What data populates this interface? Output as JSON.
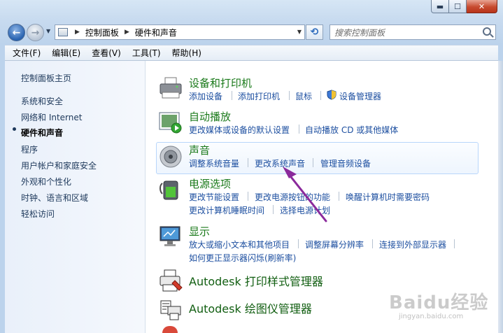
{
  "breadcrumb": {
    "root": "控制面板",
    "current": "硬件和声音"
  },
  "search": {
    "placeholder": "搜索控制面板"
  },
  "menu": [
    "文件(F)",
    "编辑(E)",
    "查看(V)",
    "工具(T)",
    "帮助(H)"
  ],
  "sidebar": {
    "home": "控制面板主页",
    "items": [
      "系统和安全",
      "网络和 Internet",
      "硬件和声音",
      "程序",
      "用户帐户和家庭安全",
      "外观和个性化",
      "时钟、语言和区域",
      "轻松访问"
    ],
    "active_index": 2
  },
  "categories": {
    "devices": {
      "title": "设备和打印机",
      "tasks": [
        "添加设备",
        "添加打印机",
        "鼠标",
        "设备管理器"
      ]
    },
    "autoplay": {
      "title": "自动播放",
      "tasks": [
        "更改媒体或设备的默认设置",
        "自动播放 CD 或其他媒体"
      ]
    },
    "sound": {
      "title": "声音",
      "tasks": [
        "调整系统音量",
        "更改系统声音",
        "管理音频设备"
      ]
    },
    "power": {
      "title": "电源选项",
      "tasks": [
        "更改节能设置",
        "更改电源按钮的功能",
        "唤醒计算机时需要密码",
        "更改计算机睡眠时间",
        "选择电源计划"
      ]
    },
    "display": {
      "title": "显示",
      "tasks": [
        "放大或缩小文本和其他项目",
        "调整屏幕分辨率",
        "连接到外部显示器",
        "如何更正显示器闪烁(刷新率)"
      ]
    },
    "autodesk_print": {
      "title": "Autodesk 打印样式管理器"
    },
    "autodesk_plotter": {
      "title": "Autodesk 绘图仪管理器"
    }
  },
  "watermark": {
    "text": "Baidu经验",
    "sub": "jingyan.baidu.com"
  },
  "colors": {
    "link": "#1d4fa0",
    "category": "#1b7a1b",
    "arrow": "#8b2a9c"
  }
}
